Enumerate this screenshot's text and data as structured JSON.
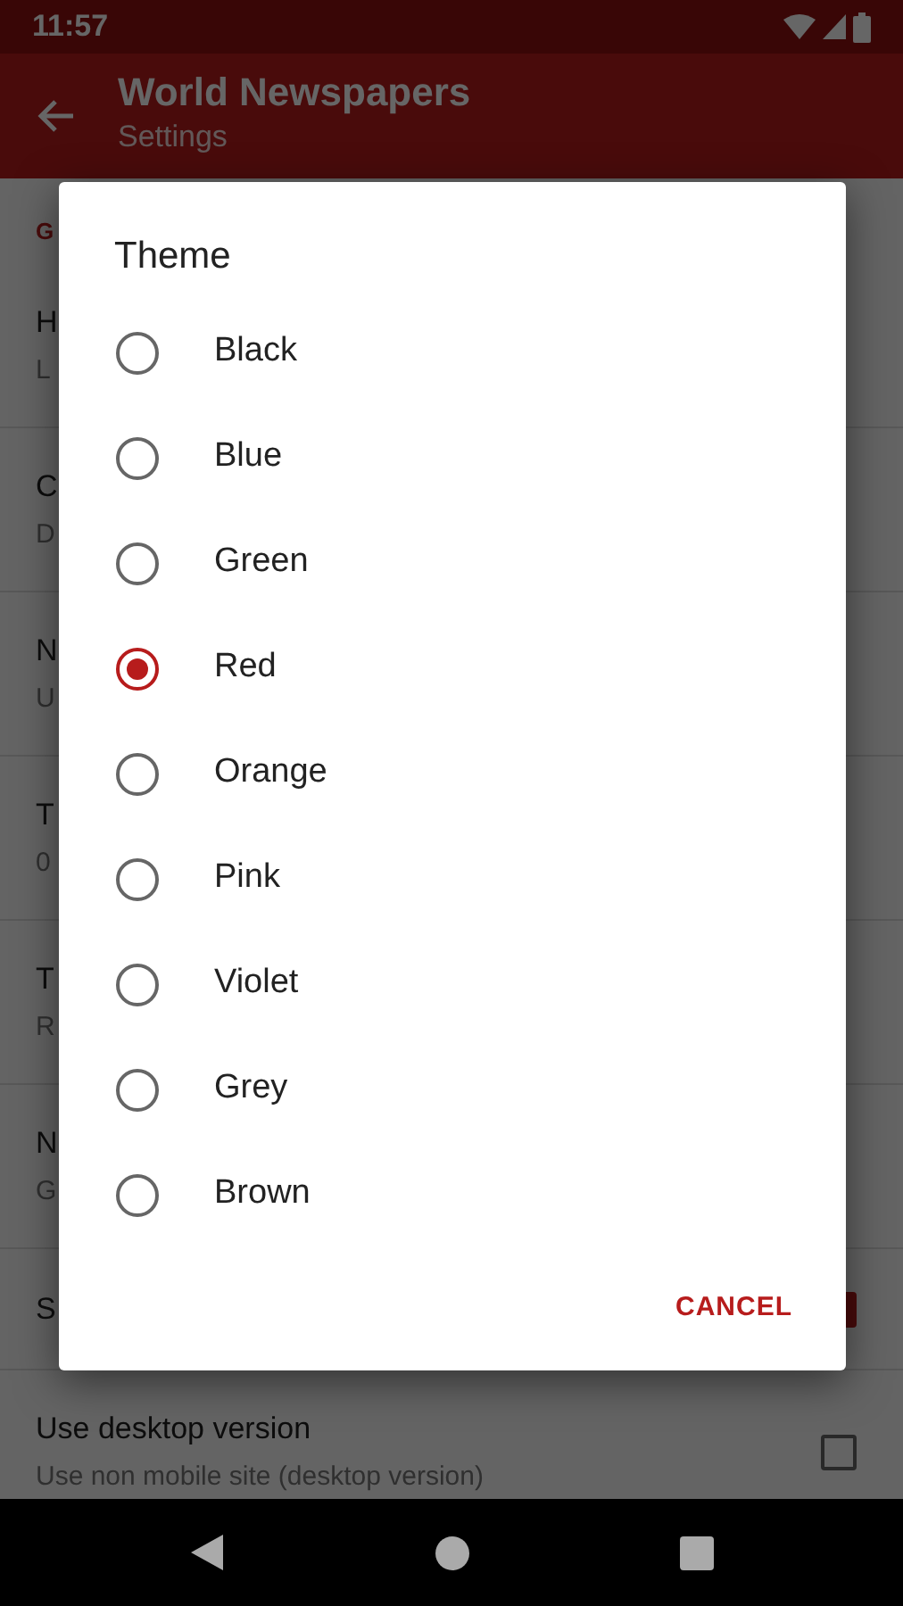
{
  "status_bar": {
    "time": "11:57"
  },
  "app_bar": {
    "title": "World Newspapers",
    "subtitle": "Settings"
  },
  "settings": {
    "section_header": "G",
    "items": [
      {
        "kind": "two_line",
        "title": "H",
        "summary": "L"
      },
      {
        "kind": "two_line",
        "title": "C",
        "summary": "D"
      },
      {
        "kind": "two_line",
        "title": "N",
        "summary": "U"
      },
      {
        "kind": "two_line",
        "title": "T",
        "summary": "0"
      },
      {
        "kind": "two_line",
        "title": "T",
        "summary": "R"
      },
      {
        "kind": "two_line",
        "title": "N",
        "summary": "G"
      },
      {
        "kind": "checkbox",
        "title": "S",
        "checked": true
      },
      {
        "kind": "checkbox",
        "title": "Use desktop version",
        "summary": "Use non mobile site (desktop version)",
        "checked": false
      }
    ]
  },
  "dialog": {
    "title": "Theme",
    "options": [
      {
        "label": "Black",
        "selected": false
      },
      {
        "label": "Blue",
        "selected": false
      },
      {
        "label": "Green",
        "selected": false
      },
      {
        "label": "Red",
        "selected": true
      },
      {
        "label": "Orange",
        "selected": false
      },
      {
        "label": "Pink",
        "selected": false
      },
      {
        "label": "Violet",
        "selected": false
      },
      {
        "label": "Grey",
        "selected": false
      },
      {
        "label": "Brown",
        "selected": false
      }
    ],
    "buttons": [
      "CANCEL"
    ]
  }
}
